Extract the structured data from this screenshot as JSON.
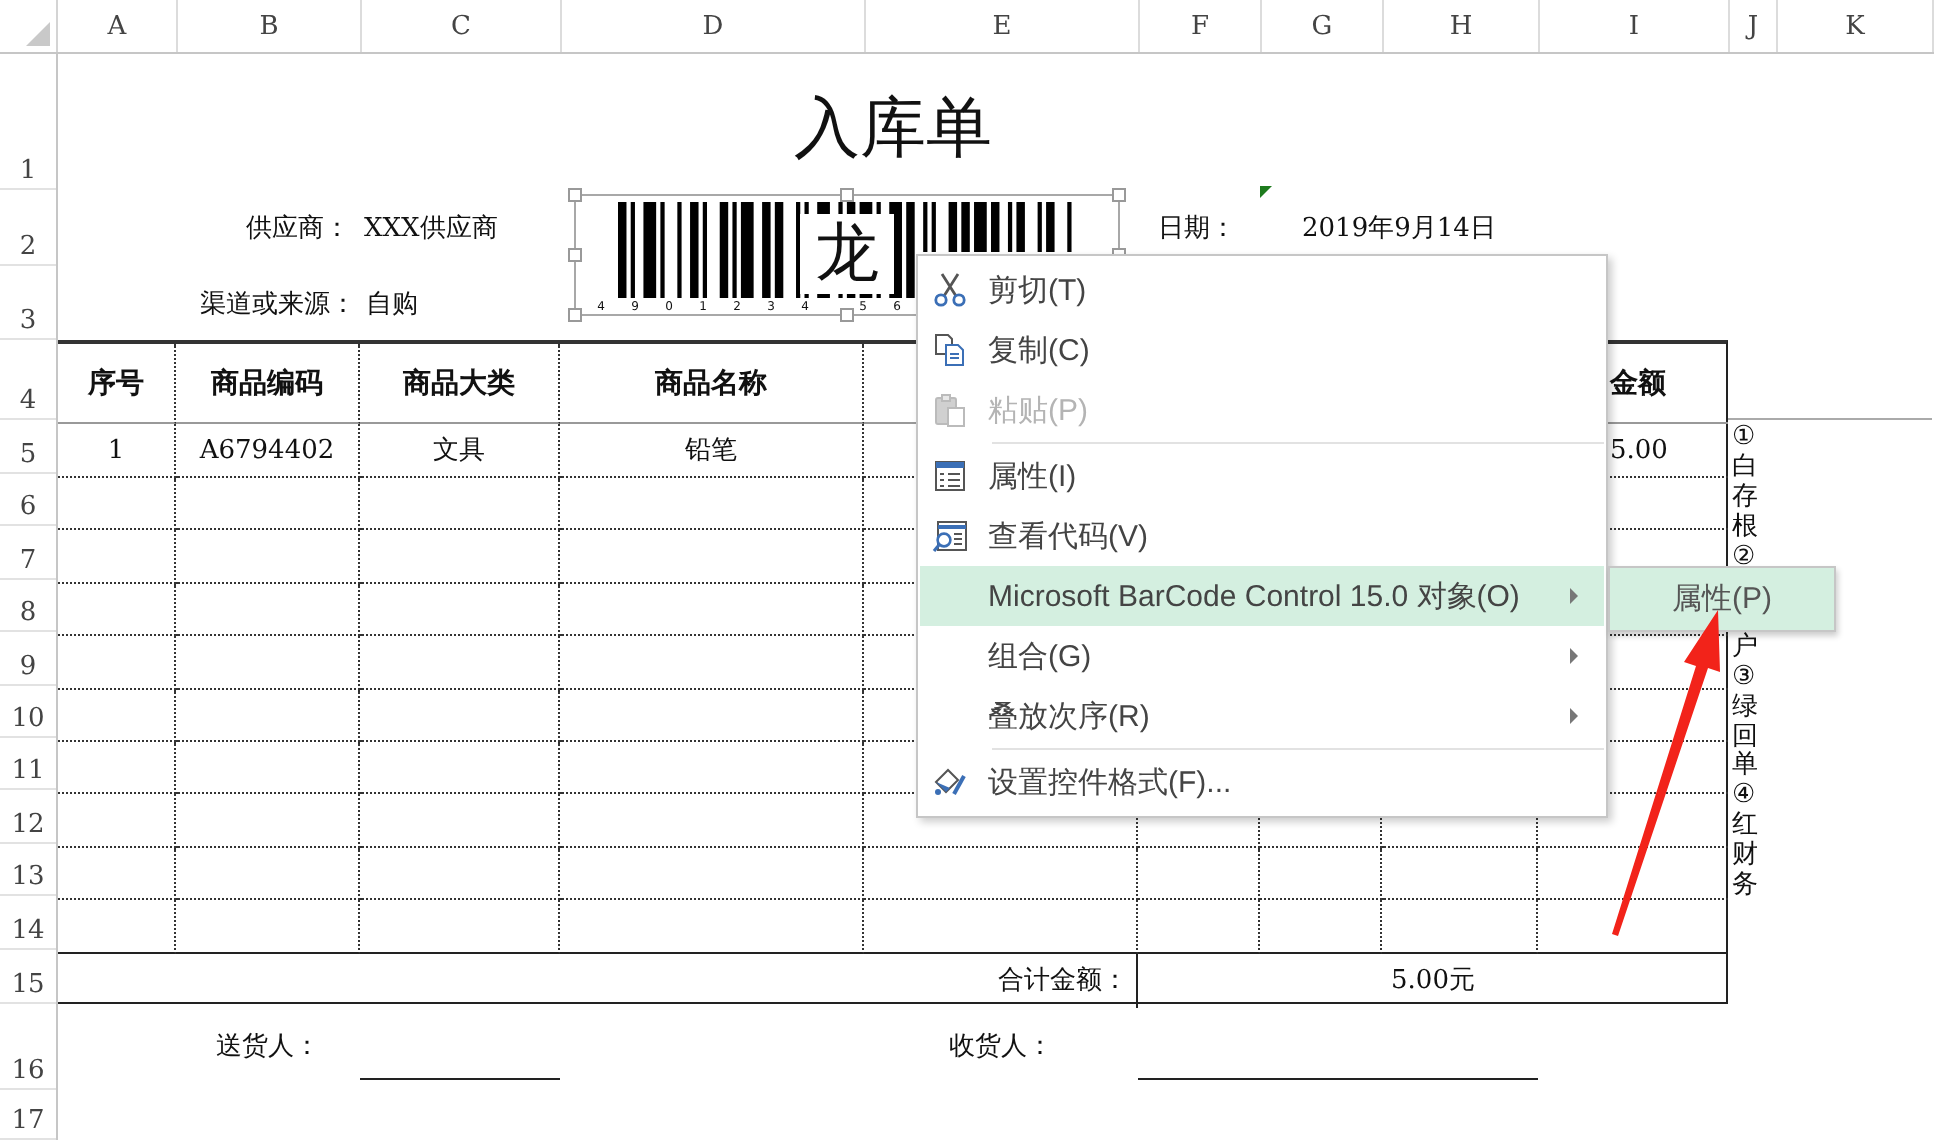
{
  "column_headers": [
    "A",
    "B",
    "C",
    "D",
    "E",
    "F",
    "G",
    "H",
    "I",
    "J",
    "K"
  ],
  "row_headers": [
    "1",
    "2",
    "3",
    "4",
    "5",
    "6",
    "7",
    "8",
    "9",
    "10",
    "11",
    "12",
    "13",
    "14",
    "15",
    "16",
    "17"
  ],
  "title": "入库单",
  "supplier": {
    "label": "供应商：",
    "value": "XXX供应商"
  },
  "channel": {
    "label": "渠道或来源：",
    "value": "自购"
  },
  "date": {
    "label": "日期：",
    "value": "2019年9月14日"
  },
  "barcode": {
    "label": "龙",
    "digits": [
      "4",
      "9",
      "0",
      "1",
      "2",
      "3",
      "4",
      "5",
      "6"
    ]
  },
  "table": {
    "columns": [
      "序号",
      "商品编码",
      "商品大类",
      "商品名称"
    ],
    "last_column": "金额",
    "rows": [
      {
        "cells": [
          "1",
          "A6794402",
          "文具",
          "铅笔"
        ],
        "last_cell": "5.00"
      }
    ],
    "total": {
      "label": "合计金额：",
      "value": "5.00元"
    }
  },
  "signatures": {
    "deliverer": "送货人：",
    "receiver": "收货人："
  },
  "side_note": [
    "①白存根②",
    "户③绿回单④红财务"
  ],
  "context_menu": {
    "items": [
      {
        "kind": "command",
        "label": "剪切(T)",
        "disabled": false,
        "selected": false,
        "submenu": false
      },
      {
        "kind": "command",
        "label": "复制(C)",
        "disabled": false,
        "selected": false,
        "submenu": false
      },
      {
        "kind": "command",
        "label": "粘贴(P)",
        "disabled": true,
        "selected": false,
        "submenu": false
      },
      {
        "kind": "separator"
      },
      {
        "kind": "command",
        "label": "属性(I)",
        "disabled": false,
        "selected": false,
        "submenu": false
      },
      {
        "kind": "command",
        "label": "查看代码(V)",
        "disabled": false,
        "selected": false,
        "submenu": false
      },
      {
        "kind": "command",
        "label": "Microsoft BarCode Control 15.0 对象(O)",
        "disabled": false,
        "selected": true,
        "submenu": true
      },
      {
        "kind": "command",
        "label": "组合(G)",
        "disabled": false,
        "selected": false,
        "submenu": true
      },
      {
        "kind": "command",
        "label": "叠放次序(R)",
        "disabled": false,
        "selected": false,
        "submenu": true
      },
      {
        "kind": "separator"
      },
      {
        "kind": "command",
        "label": "设置控件格式(F)...",
        "disabled": false,
        "selected": false,
        "submenu": false
      }
    ]
  },
  "submenu": {
    "items": [
      {
        "label": "属性(P)",
        "selected": true
      }
    ]
  }
}
